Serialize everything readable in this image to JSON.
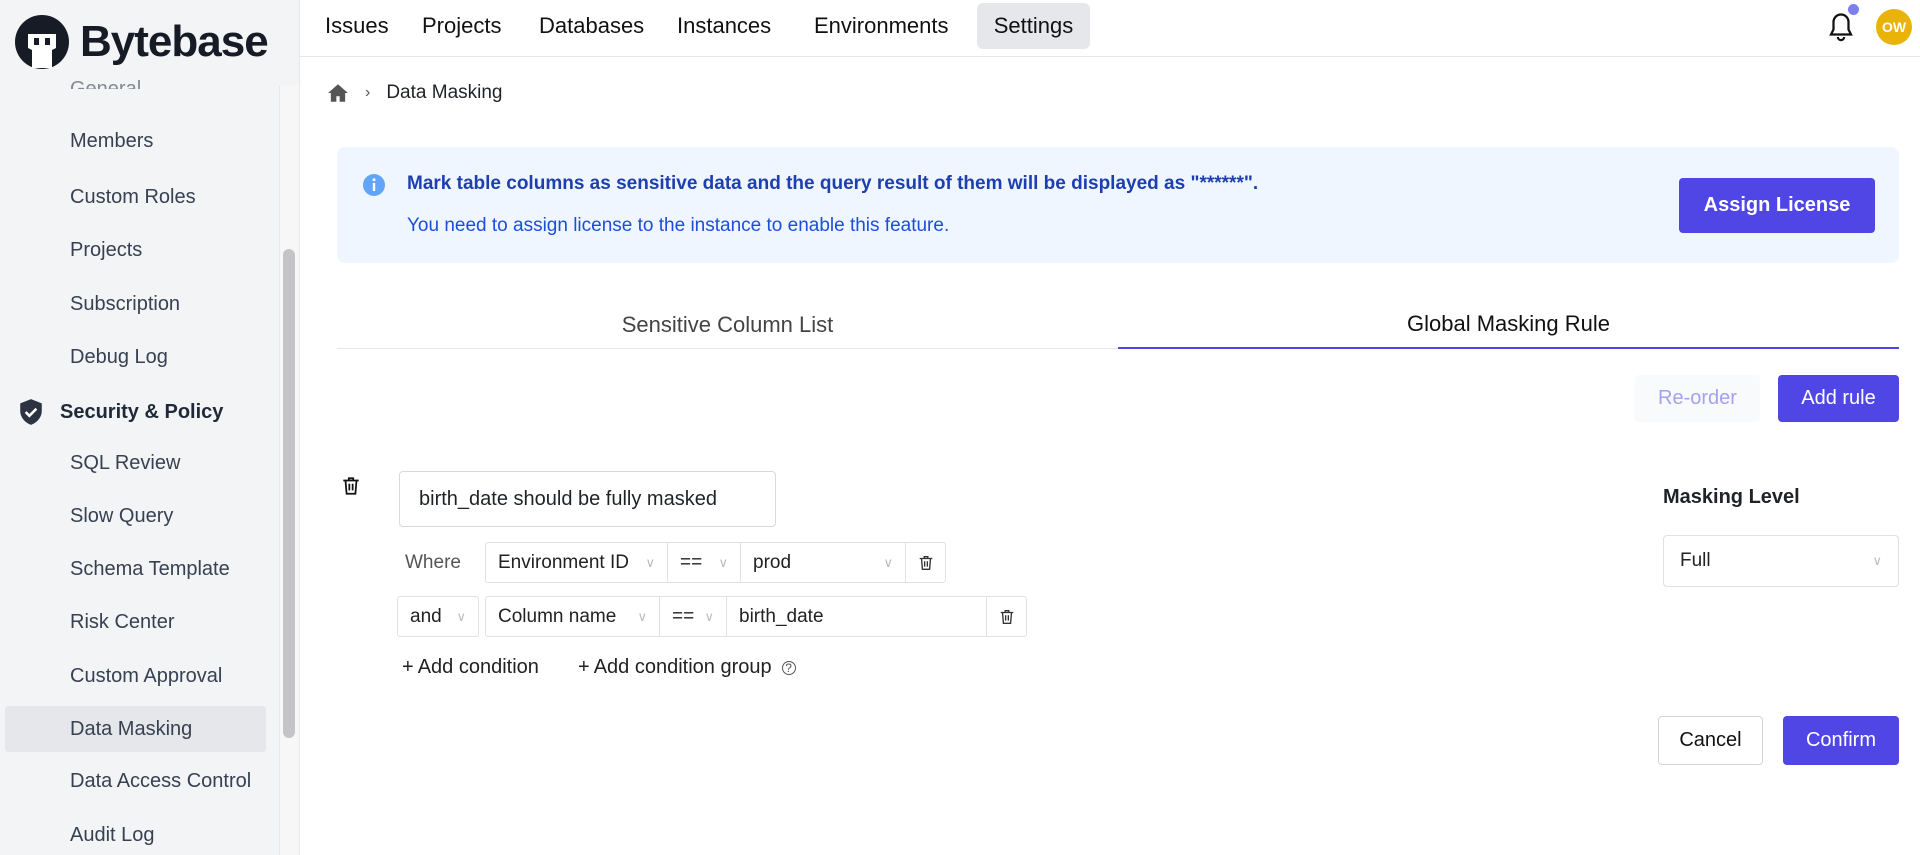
{
  "brand": {
    "name": "Bytebase"
  },
  "sidebar": {
    "cut_item": "General",
    "items": [
      {
        "label": "Members"
      },
      {
        "label": "Custom Roles"
      },
      {
        "label": "Projects"
      },
      {
        "label": "Subscription"
      },
      {
        "label": "Debug Log"
      }
    ],
    "section": {
      "label": "Security & Policy",
      "icon": "shield-check-icon"
    },
    "section_items": [
      {
        "label": "SQL Review"
      },
      {
        "label": "Slow Query"
      },
      {
        "label": "Schema Template"
      },
      {
        "label": "Risk Center"
      },
      {
        "label": "Custom Approval"
      },
      {
        "label": "Data Masking",
        "active": true
      },
      {
        "label": "Data Access Control"
      },
      {
        "label": "Audit Log"
      }
    ]
  },
  "topnav": {
    "items": [
      {
        "label": "Issues"
      },
      {
        "label": "Projects"
      },
      {
        "label": "Databases"
      },
      {
        "label": "Instances"
      },
      {
        "label": "Environments"
      },
      {
        "label": "Settings",
        "active": true
      }
    ],
    "avatar": "OW"
  },
  "breadcrumb": {
    "current": "Data Masking"
  },
  "banner": {
    "title": "Mark table columns as sensitive data and the query result of them will be displayed as \"******\".",
    "subtitle": "You need to assign license to the instance to enable this feature.",
    "button": "Assign License"
  },
  "tabs": [
    {
      "label": "Sensitive Column List"
    },
    {
      "label": "Global Masking Rule",
      "active": true
    }
  ],
  "actions": {
    "reorder": "Re-order",
    "add_rule": "Add rule"
  },
  "rule": {
    "title": "birth_date should be fully masked",
    "where_label": "Where",
    "conditions": [
      {
        "conjunction": "",
        "field": "Environment ID",
        "op": "==",
        "value": "prod"
      },
      {
        "conjunction": "and",
        "field": "Column name",
        "op": "==",
        "value": "birth_date"
      }
    ],
    "add_condition": "Add condition",
    "add_condition_group": "Add condition group",
    "masking_level_label": "Masking Level",
    "masking_level": "Full",
    "cancel": "Cancel",
    "confirm": "Confirm"
  },
  "colors": {
    "primary": "#4f46e5",
    "banner_bg": "#eff6ff",
    "banner_text": "#1e40af",
    "avatar": "#eab308"
  }
}
